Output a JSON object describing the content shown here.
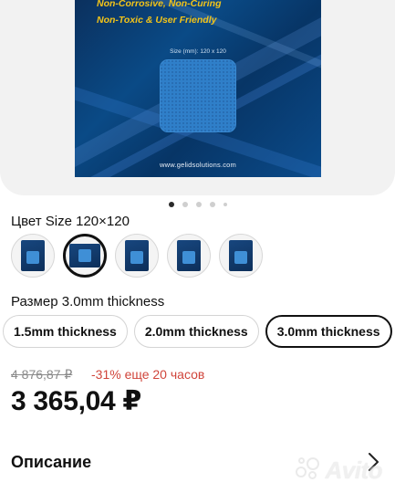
{
  "gallery": {
    "box_line1": "Non-Corrosive, Non-Curing",
    "box_line2": "Non-Toxic & User Friendly",
    "size_label": "Size (mm): 120 x 120",
    "website": "www.gelidsolutions.com",
    "dots_count": 5,
    "active_dot": 0
  },
  "color": {
    "label": "Цвет Size 120×120",
    "swatches": [
      "variant-1",
      "variant-2",
      "variant-3",
      "variant-4",
      "variant-5"
    ],
    "selected_index": 1
  },
  "size": {
    "label": "Размер 3.0mm thickness",
    "options": [
      "1.5mm thickness",
      "2.0mm thickness",
      "3.0mm thickness"
    ],
    "selected_index": 2
  },
  "price": {
    "old": "4 876,87 ₽",
    "discount": "-31% еще 20 часов",
    "current": "3 365,04 ₽"
  },
  "description": {
    "title": "Описание"
  },
  "watermark": {
    "text": "Avito"
  },
  "icons": {
    "chevron": "chevron-right-icon",
    "watermark_logo": "avito-logo-icon"
  }
}
